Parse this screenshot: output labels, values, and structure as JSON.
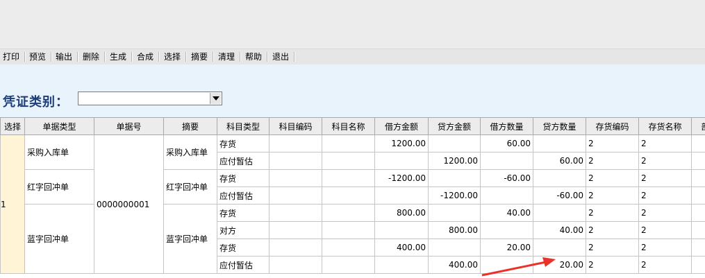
{
  "toolbar": {
    "buttons": [
      "打印",
      "预览",
      "输出",
      "删除",
      "生成",
      "合成",
      "选择",
      "摘要",
      "清理",
      "帮助",
      "退出"
    ]
  },
  "header": {
    "voucher_type_label": "凭证类别：",
    "voucher_type_value": ""
  },
  "table": {
    "columns": [
      "选择",
      "单据类型",
      "单据号",
      "摘要",
      "科目类型",
      "科目编码",
      "科目名称",
      "借方金额",
      "贷方金额",
      "借方数量",
      "贷方数量",
      "存货编码",
      "存货名称",
      "部"
    ],
    "groups": [
      {
        "doc_type": "采购入库单",
        "summary": "采购入库单",
        "rows": [
          {
            "subject_type": "存货",
            "debit_amt": "1200.00",
            "credit_amt": "",
            "debit_qty": "60.00",
            "credit_qty": "",
            "inv_code": "2",
            "inv_name": "2"
          },
          {
            "subject_type": "应付暂估",
            "debit_amt": "",
            "credit_amt": "1200.00",
            "debit_qty": "",
            "credit_qty": "60.00",
            "inv_code": "2",
            "inv_name": "2"
          }
        ]
      },
      {
        "doc_type": "红字回冲单",
        "summary": "红字回冲单",
        "rows": [
          {
            "subject_type": "存货",
            "debit_amt": "-1200.00",
            "credit_amt": "",
            "debit_qty": "-60.00",
            "credit_qty": "",
            "inv_code": "2",
            "inv_name": "2"
          },
          {
            "subject_type": "应付暂估",
            "debit_amt": "",
            "credit_amt": "-1200.00",
            "debit_qty": "",
            "credit_qty": "-60.00",
            "inv_code": "2",
            "inv_name": "2"
          }
        ]
      },
      {
        "doc_type": "蓝字回冲单",
        "summary": "蓝字回冲单",
        "rows": [
          {
            "subject_type": "存货",
            "debit_amt": "800.00",
            "credit_amt": "",
            "debit_qty": "40.00",
            "credit_qty": "",
            "inv_code": "2",
            "inv_name": "2"
          },
          {
            "subject_type": "对方",
            "debit_amt": "",
            "credit_amt": "800.00",
            "debit_qty": "",
            "credit_qty": "40.00",
            "inv_code": "2",
            "inv_name": "2"
          },
          {
            "subject_type": "存货",
            "debit_amt": "400.00",
            "credit_amt": "",
            "debit_qty": "20.00",
            "credit_qty": "",
            "inv_code": "2",
            "inv_name": "2"
          },
          {
            "subject_type": "应付暂估",
            "debit_amt": "",
            "credit_amt": "400.00",
            "debit_qty": "",
            "credit_qty": "20.00",
            "inv_code": "2",
            "inv_name": "2"
          }
        ]
      }
    ],
    "doc_no": "0000000001",
    "select_mark": "1"
  },
  "colors": {
    "header_label": "#1c3d7a",
    "header_bg": "#e9f3fb",
    "select_bg": "#fff5d6",
    "annotation_arrow": "#e8322a"
  }
}
